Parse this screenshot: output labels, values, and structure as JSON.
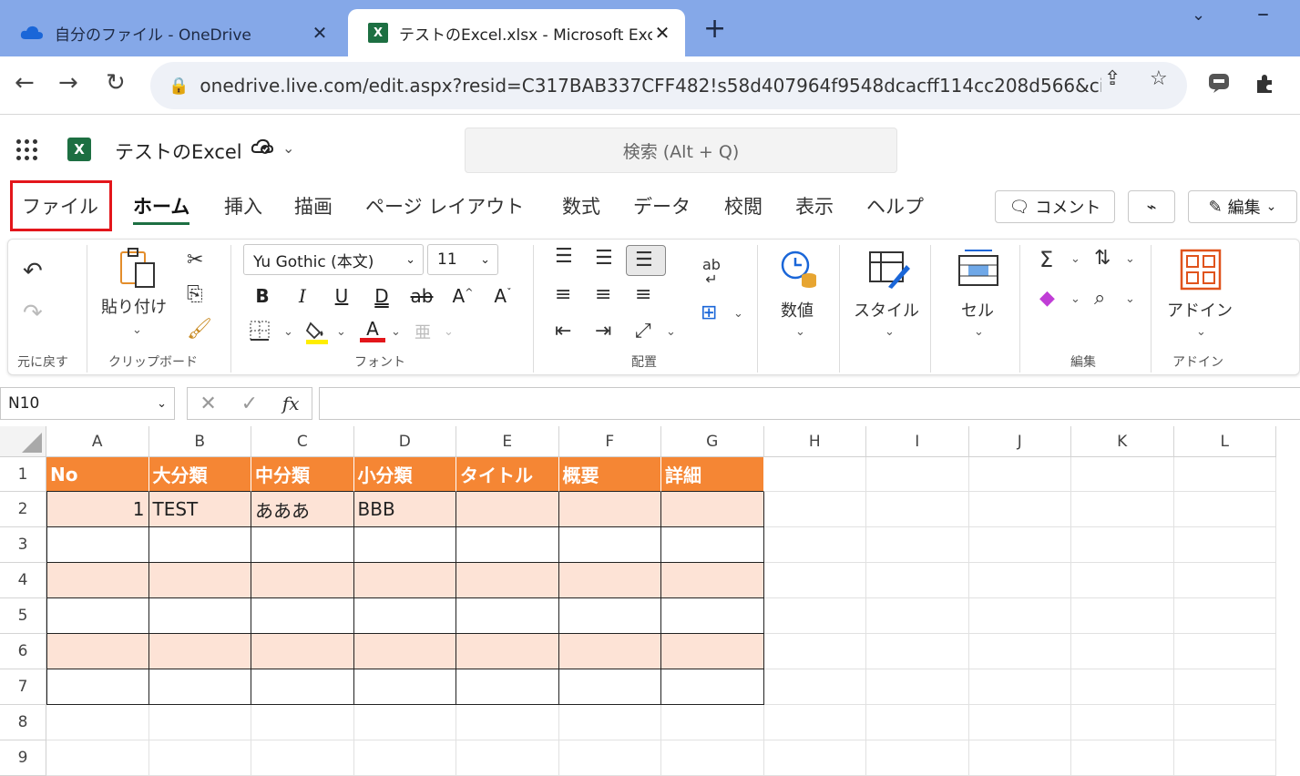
{
  "browser": {
    "tabs": [
      {
        "title": "自分のファイル - OneDrive",
        "icon": "onedrive-cloud-icon"
      },
      {
        "title": "テストのExcel.xlsx - Microsoft Excel",
        "icon": "excel-icon"
      }
    ],
    "close_glyph": "✕",
    "new_tab_glyph": "+",
    "url": "onedrive.live.com/edit.aspx?resid=C317BAB337CFF482!s58d407964f9548dcacff114cc208d566&cid=..."
  },
  "app": {
    "logo": "X",
    "doc_title": "テストのExcel",
    "search_placeholder": "検索 (Alt + Q)"
  },
  "menu": {
    "tabs": [
      "ファイル",
      "ホーム",
      "挿入",
      "描画",
      "ページ レイアウト",
      "数式",
      "データ",
      "校閲",
      "表示",
      "ヘルプ"
    ],
    "active": "ホーム",
    "comment_label": "コメント",
    "edit_label": "編集"
  },
  "ribbon": {
    "groups": {
      "undo": "元に戻す",
      "clipboard": "クリップボード",
      "font": "フォント",
      "alignment": "配置",
      "editing": "編集",
      "addins": "アドイン"
    },
    "paste_label": "貼り付け",
    "font_name": "Yu Gothic (本文)",
    "font_size": "11",
    "number_label": "数値",
    "styles_label": "スタイル",
    "cells_label": "セル",
    "addins_label": "アドイン",
    "font_buttons": [
      "B",
      "I",
      "U",
      "D",
      "ab",
      "A^",
      "Aˇ"
    ],
    "bold": "B",
    "italic": "I",
    "underline": "U",
    "double_underline": "D",
    "strike": "ab",
    "grow_font": "A",
    "shrink_font": "A",
    "font_color_letter": "A"
  },
  "formula_bar": {
    "name_box": "N10",
    "fx": "fx",
    "cancel": "✕",
    "enter": "✓"
  },
  "sheet": {
    "columns": [
      "A",
      "B",
      "C",
      "D",
      "E",
      "F",
      "G",
      "H",
      "I",
      "J",
      "K",
      "L"
    ],
    "rows": [
      "1",
      "2",
      "3",
      "4",
      "5",
      "6",
      "7",
      "8",
      "9"
    ],
    "header_row": [
      "No",
      "大分類",
      "中分類",
      "小分類",
      "タイトル",
      "概要",
      "詳細"
    ],
    "data_rows": [
      [
        "1",
        "TEST",
        "あああ",
        "BBB",
        "",
        "",
        ""
      ]
    ],
    "colors": {
      "header_fill": "#f58634",
      "band_fill": "#fde3d6",
      "highlight": "#e3161b"
    }
  }
}
